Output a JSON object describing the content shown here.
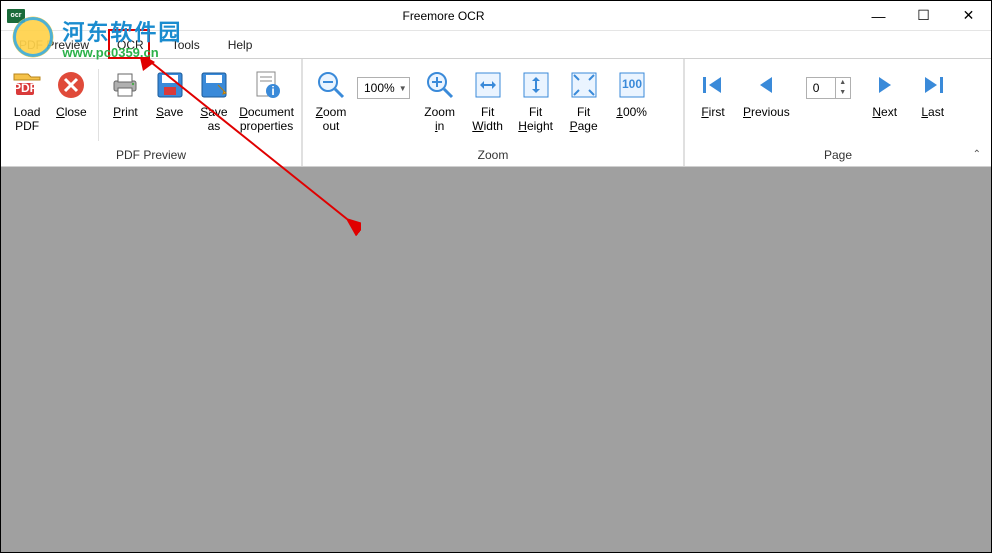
{
  "window": {
    "title": "Freemore OCR",
    "app_badge": "ocr"
  },
  "winbuttons": {
    "min": "—",
    "max": "☐",
    "close": "✕"
  },
  "menu": {
    "pdf_preview": "PDF Preview",
    "ocr": "OCR",
    "tools": "Tools",
    "help": "Help"
  },
  "ribbon": {
    "group_pdf": {
      "label": "PDF Preview",
      "load_pdf_l1": "Load",
      "load_pdf_l2": "PDF",
      "close": "Close",
      "print": "Print",
      "save": "Save",
      "saveas_l1": "Save",
      "saveas_l2": "as",
      "docprops_l1": "Document",
      "docprops_l2": "properties"
    },
    "group_zoom": {
      "label": "Zoom",
      "zoomout_l1": "Zoom",
      "zoomout_l2": "out",
      "zoom_value": "100%",
      "zoomin_l1": "Zoom",
      "zoomin_l2": "in",
      "fitwidth_l1": "Fit",
      "fitwidth_l2": "Width",
      "fitheight_l1": "Fit",
      "fitheight_l2": "Height",
      "fitpage_l1": "Fit",
      "fitpage_l2": "Page",
      "hundred": "100%"
    },
    "group_page": {
      "label": "Page",
      "first": "First",
      "previous": "Previous",
      "page_value": "0",
      "next": "Next",
      "last": "Last"
    }
  },
  "watermark": {
    "cn_text": "河东软件园",
    "url_text": "www.pc0359.cn"
  }
}
